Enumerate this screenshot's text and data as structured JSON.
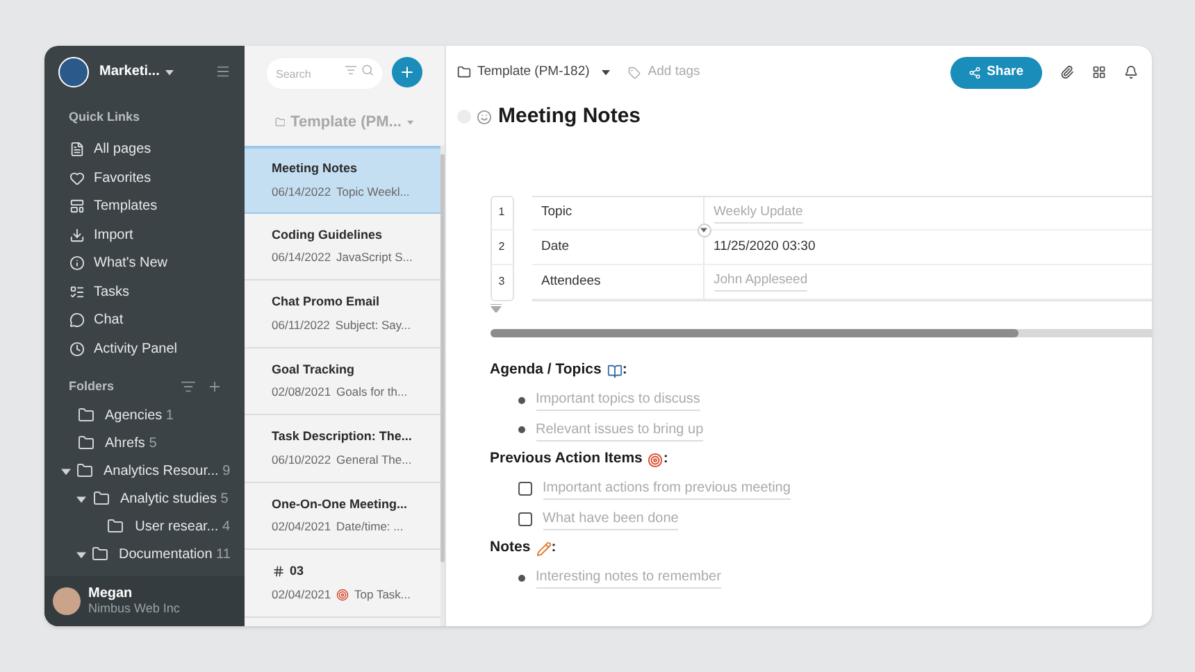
{
  "workspace": {
    "name": "Marketi..."
  },
  "quick_links": {
    "title": "Quick Links",
    "items": [
      {
        "label": "All pages"
      },
      {
        "label": "Favorites"
      },
      {
        "label": "Templates"
      },
      {
        "label": "Import"
      },
      {
        "label": "What's New"
      },
      {
        "label": "Tasks"
      },
      {
        "label": "Chat"
      },
      {
        "label": "Activity Panel"
      }
    ]
  },
  "folders": {
    "title": "Folders",
    "items": [
      {
        "label": "Agencies",
        "count": "1"
      },
      {
        "label": "Ahrefs",
        "count": "5"
      },
      {
        "label": "Analytics Resour...",
        "count": "9",
        "expanded": true,
        "children": [
          {
            "label": "Analytic studies",
            "count": "5",
            "expanded": true,
            "children": [
              {
                "label": "User resear...",
                "count": "4"
              }
            ]
          },
          {
            "label": "Documentation",
            "count": "11",
            "expanded": true
          }
        ]
      }
    ]
  },
  "user": {
    "name": "Megan",
    "org": "Nimbus Web Inc"
  },
  "page_list": {
    "search": {
      "placeholder": "Search"
    },
    "folder": "Template (PM...",
    "items": [
      {
        "title": "Meeting Notes",
        "date": "06/14/2022",
        "snippet": "Topic Weekl...",
        "selected": true
      },
      {
        "title": "Coding Guidelines",
        "date": "06/14/2022",
        "snippet": "JavaScript S...",
        "selected": false
      },
      {
        "title": "Chat Promo Email",
        "date": "06/11/2022",
        "snippet": "Subject: Say...",
        "selected": false
      },
      {
        "title": "Goal Tracking",
        "date": "02/08/2021",
        "snippet": "Goals for th...",
        "selected": false
      },
      {
        "title": "Task Description: The...",
        "date": "06/10/2022",
        "snippet": "General The...",
        "selected": false
      },
      {
        "title": "One-On-One Meeting...",
        "date": "02/04/2021",
        "snippet": "Date/time: ...",
        "selected": false
      },
      {
        "title": "03",
        "date": "02/04/2021",
        "snippet": "Top Task...",
        "selected": false
      }
    ]
  },
  "header": {
    "breadcrumb": "Template (PM-182)",
    "tags_placeholder": "Add tags",
    "share": "Share"
  },
  "page": {
    "title": "Meeting Notes",
    "table": {
      "rows": [
        {
          "index": "1",
          "label": "Topic",
          "value": "Weekly Update",
          "kind": "placeholder"
        },
        {
          "index": "2",
          "label": "Date",
          "value": "11/25/2020 03:30",
          "kind": "value"
        },
        {
          "index": "3",
          "label": "Attendees",
          "value": "John Appleseed",
          "kind": "placeholder"
        }
      ]
    },
    "sections": [
      {
        "heading": "Agenda / Topics",
        "items": [
          {
            "text": "Important topics to discuss",
            "kind": "bullet"
          },
          {
            "text": "Relevant issues to bring up",
            "kind": "bullet"
          }
        ]
      },
      {
        "heading": "Previous Action Items",
        "items": [
          {
            "text": "Important actions from previous meeting",
            "kind": "checkbox",
            "checked": false
          },
          {
            "text": "What have been done",
            "kind": "checkbox",
            "checked": false
          }
        ]
      },
      {
        "heading": "Notes",
        "items": [
          {
            "text": "Interesting notes to remember",
            "kind": "bullet"
          }
        ]
      }
    ],
    "heading_suffix": ":"
  }
}
